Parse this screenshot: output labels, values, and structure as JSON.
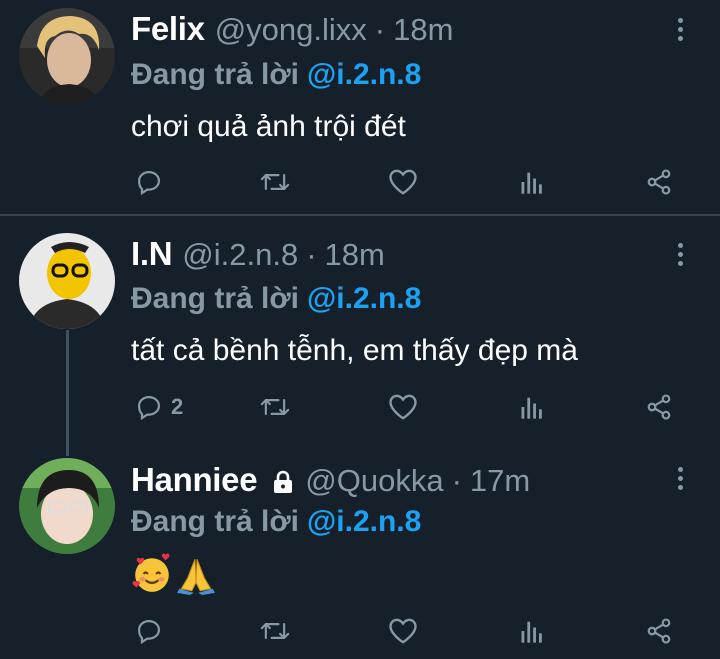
{
  "reply_prefix": "Đang trả lời",
  "tweets": [
    {
      "name": "Felix",
      "handle": "@yong.lixx",
      "separator": "·",
      "time": "18m",
      "reply_to": "@i.2.n.8",
      "text": "chơi quả ảnh trội đét",
      "reply_count": ""
    },
    {
      "name": "I.N",
      "handle": "@i.2.n.8",
      "separator": "·",
      "time": "18m",
      "reply_to": "@i.2.n.8",
      "text": "tất cả bềnh tễnh, em thấy đẹp mà",
      "reply_count": "2"
    },
    {
      "name": "Hanniee",
      "handle": "@Quokka",
      "separator": "·",
      "time": "17m",
      "reply_to": "@i.2.n.8",
      "text": "",
      "emojis": [
        "smiling-face-with-hearts",
        "folded-hands"
      ],
      "reply_count": "",
      "protected": true
    }
  ],
  "colors": {
    "background": "#15202b",
    "secondary_text": "#8899a6",
    "accent": "#1da1f2",
    "divider": "#38444d"
  }
}
